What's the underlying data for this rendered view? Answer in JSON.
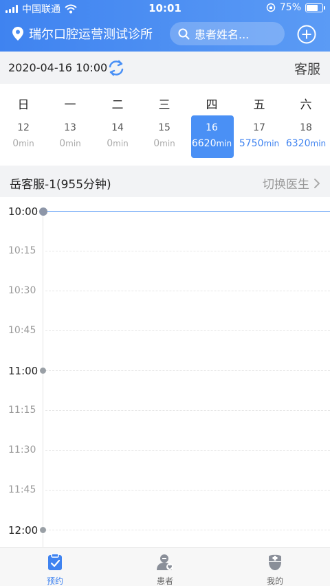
{
  "status_bar": {
    "carrier": "中国联通",
    "time": "10:01",
    "battery": "75%",
    "battery_level": 0.75
  },
  "header": {
    "clinic_name": "瑞尔口腔运营测试诊所",
    "search_placeholder": "患者姓名..."
  },
  "date_bar": {
    "date": "2020-04-16 10:00",
    "service_label": "客服"
  },
  "week": {
    "days": [
      {
        "weekday": "日",
        "date": "12",
        "minutes": "0",
        "unit": "min",
        "active": false,
        "has": false
      },
      {
        "weekday": "一",
        "date": "13",
        "minutes": "0",
        "unit": "min",
        "active": false,
        "has": false
      },
      {
        "weekday": "二",
        "date": "14",
        "minutes": "0",
        "unit": "min",
        "active": false,
        "has": false
      },
      {
        "weekday": "三",
        "date": "15",
        "minutes": "0",
        "unit": "min",
        "active": false,
        "has": false
      },
      {
        "weekday": "四",
        "date": "16",
        "minutes": "6620",
        "unit": "min",
        "active": true,
        "has": true
      },
      {
        "weekday": "五",
        "date": "17",
        "minutes": "5750",
        "unit": "min",
        "active": false,
        "has": true
      },
      {
        "weekday": "六",
        "date": "18",
        "minutes": "6320",
        "unit": "min",
        "active": false,
        "has": true
      }
    ]
  },
  "doctor_bar": {
    "doctor": "岳客服-1(955分钟)",
    "switch_label": "切换医生"
  },
  "timeline": {
    "slots": [
      {
        "time": "10:00",
        "hour": true,
        "current": true
      },
      {
        "time": "10:15",
        "hour": false,
        "current": false
      },
      {
        "time": "10:30",
        "hour": false,
        "current": false
      },
      {
        "time": "10:45",
        "hour": false,
        "current": false
      },
      {
        "time": "11:00",
        "hour": true,
        "current": false
      },
      {
        "time": "11:15",
        "hour": false,
        "current": false
      },
      {
        "time": "11:30",
        "hour": false,
        "current": false
      },
      {
        "time": "11:45",
        "hour": false,
        "current": false
      },
      {
        "time": "12:00",
        "hour": true,
        "current": false
      }
    ]
  },
  "tabs": [
    {
      "label": "预约",
      "icon": "clipboard-check-icon",
      "active": true
    },
    {
      "label": "患者",
      "icon": "patient-icon",
      "active": false
    },
    {
      "label": "我的",
      "icon": "doctor-icon",
      "active": false
    }
  ],
  "colors": {
    "accent": "#3f83f0",
    "active_day": "#4a90f5",
    "muted": "#999999"
  }
}
